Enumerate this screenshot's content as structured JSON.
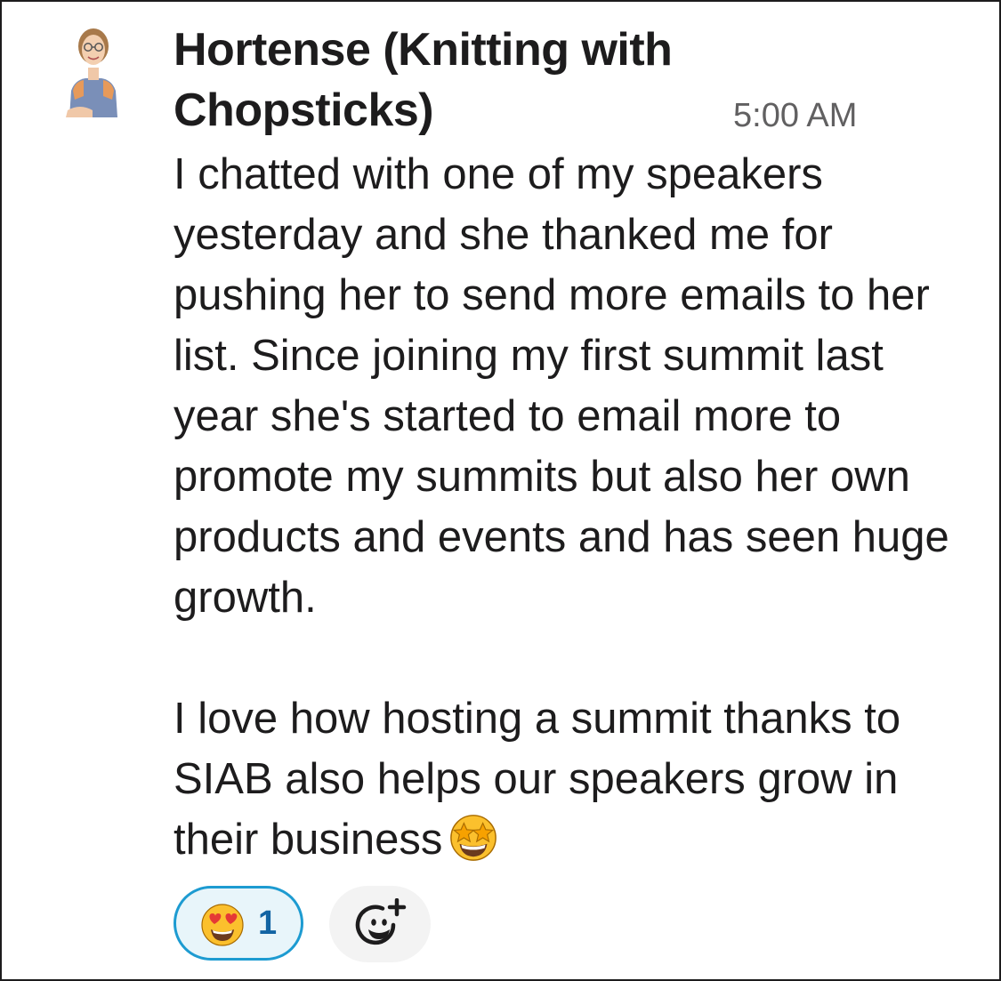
{
  "message": {
    "sender_name": "Hortense (Knitting with Chopsticks)",
    "timestamp": "5:00 AM",
    "paragraphs": [
      "I chatted with one of my speakers yesterday and she thanked me for pushing her to send more emails to her list. Since joining my first summit last year she's started to email more to promote my summits but also her own products and events and has seen huge growth.",
      "I love how hosting a summit thanks to SIAB also helps our speakers grow in their business"
    ],
    "inline_emoji": "star-struck-emoji"
  },
  "reactions": [
    {
      "emoji": "heart-eyes-emoji",
      "count": "1",
      "selected": true
    }
  ],
  "add_reaction": {
    "icon": "add-emoji-icon"
  },
  "colors": {
    "text": "#1d1c1d",
    "timestamp": "#616061",
    "reaction_border": "#1d9bd1",
    "reaction_bg": "#e8f5fa",
    "reaction_count": "#1264a3",
    "add_reaction_bg": "#f3f3f3"
  }
}
